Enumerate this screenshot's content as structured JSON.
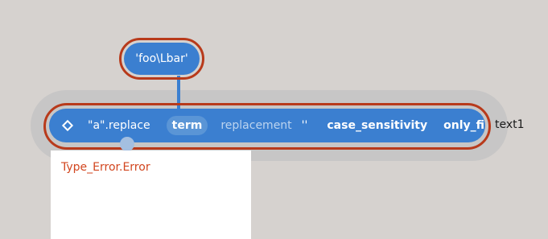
{
  "literal_node": {
    "text": "'foo\\Lbar'"
  },
  "main_node": {
    "icon": "diamond-icon",
    "method_label": "\"a\".replace",
    "term_label": "term",
    "replacement_label": "replacement",
    "replacement_value": "''",
    "case_sensitivity_label": "case_sensitivity",
    "only_first_label": "only_first"
  },
  "side_label": "text1",
  "error_panel": {
    "message": "Type_Error.Error"
  },
  "colors": {
    "background": "#d6d2cf",
    "node_blue": "#3b7fd0",
    "error_outline": "#b83a1b",
    "error_text": "#d2461f"
  }
}
